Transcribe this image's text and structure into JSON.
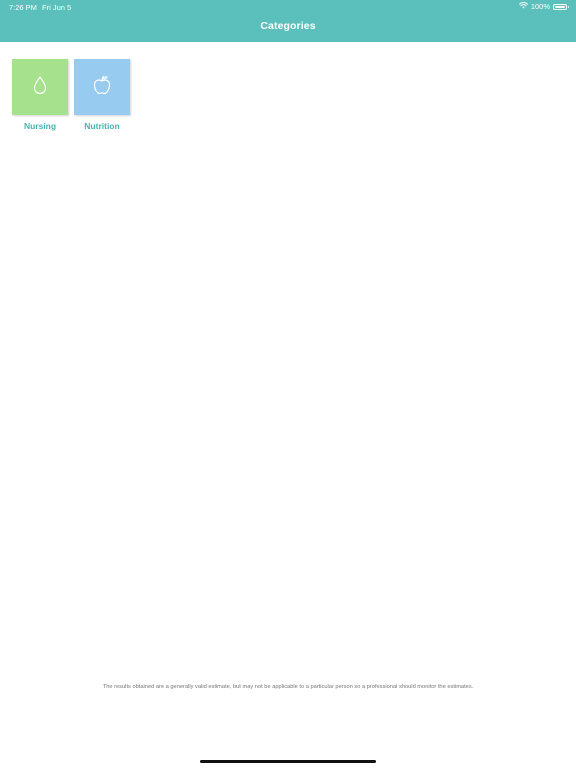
{
  "status_bar": {
    "time": "7:26 PM",
    "date": "Fri Jun 5",
    "battery_text": "100%",
    "battery_level": 1.0,
    "icons": [
      "wifi-icon",
      "battery-icon"
    ]
  },
  "header": {
    "title": "Categories"
  },
  "categories": [
    {
      "label": "Nursing",
      "icon": "drop-icon",
      "color": "#A6E28D"
    },
    {
      "label": "Nutrition",
      "icon": "apple-icon",
      "color": "#97CBF0"
    }
  ],
  "disclaimer": "The results obtained are a generally valid estimate, but may not be applicable to a particular person so a professional should monitor the estimates.",
  "colors": {
    "accent": "#5BC0BB",
    "label": "#46B3AE"
  }
}
